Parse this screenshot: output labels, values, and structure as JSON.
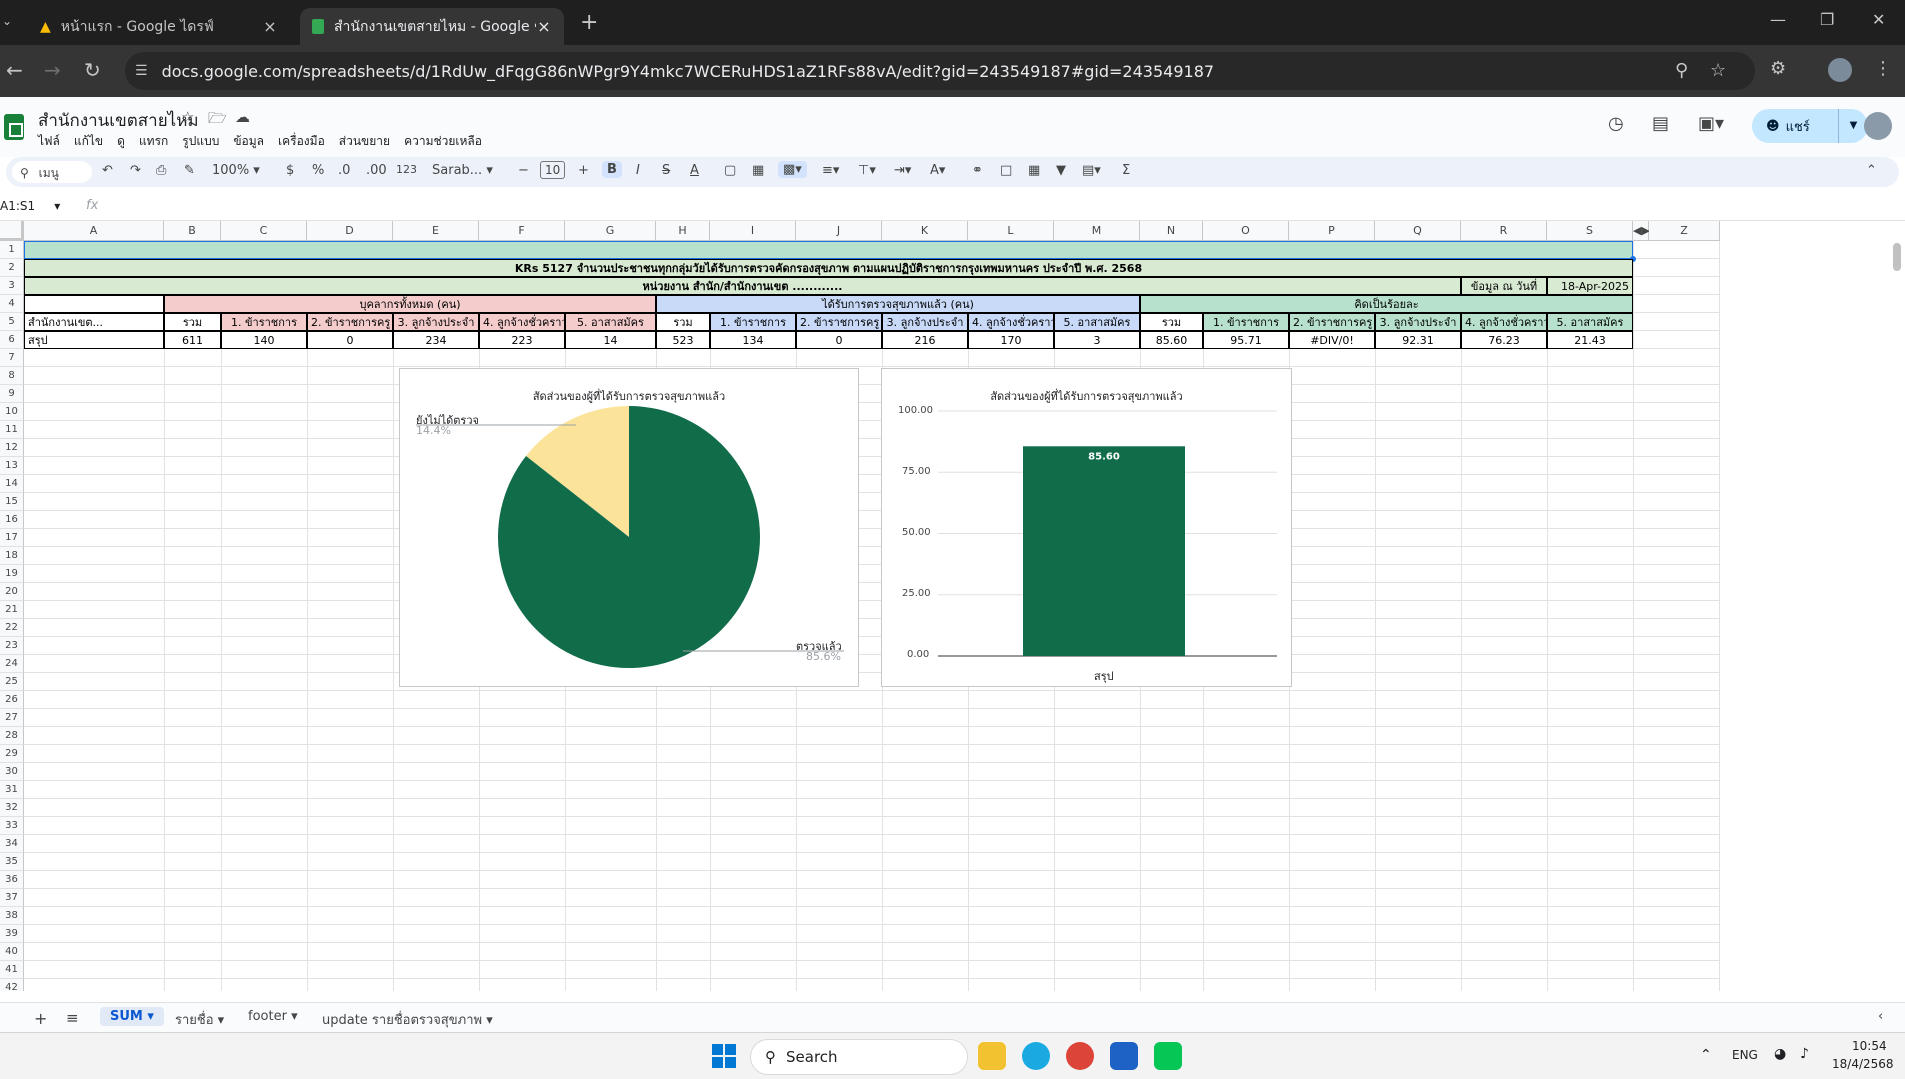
{
  "browser": {
    "tabs": [
      {
        "title": "หน้าแรก - Google ไดรฟ์"
      },
      {
        "title": "สำนักงานเขตสายไหม - Google ชีต"
      }
    ],
    "url": "docs.google.com/spreadsheets/d/1RdUw_dFqgG86nWPgr9Y4mkc7WCERuHDS1aZ1RFs88vA/edit?gid=243549187#gid=243549187"
  },
  "sheets": {
    "doc_title": "สำนักงานเขตสายไหม",
    "menu": [
      "ไฟล์",
      "แก้ไข",
      "ดู",
      "แทรก",
      "รูปแบบ",
      "ข้อมูล",
      "เครื่องมือ",
      "ส่วนขยาย",
      "ความช่วยเหลือ"
    ],
    "share_label": "แชร์",
    "toolbar": {
      "search": "เมนู",
      "zoom": "100%",
      "currency": "$",
      "percent": "%",
      "dec_less": ".0",
      "dec_more": ".00",
      "num_format": "123",
      "font": "Sarab...",
      "font_size": "10"
    },
    "name_box": "A1:S1",
    "fx": "fx"
  },
  "columns": [
    "A",
    "B",
    "C",
    "D",
    "E",
    "F",
    "G",
    "H",
    "I",
    "J",
    "K",
    "L",
    "M",
    "N",
    "O",
    "P",
    "Q",
    "R",
    "S",
    "Z"
  ],
  "rows": [
    "1",
    "2",
    "3",
    "4",
    "5",
    "6",
    "7",
    "8",
    "9",
    "10",
    "11",
    "12",
    "13",
    "14",
    "15",
    "16",
    "17",
    "18",
    "19",
    "20",
    "21",
    "22",
    "23",
    "24",
    "25",
    "26",
    "27",
    "28",
    "29",
    "30",
    "31",
    "32",
    "33",
    "34",
    "35",
    "36",
    "37",
    "38",
    "39",
    "40",
    "41",
    "42"
  ],
  "table": {
    "title": "KRs 5127 จำนวนประชาชนทุกกลุ่มวัยได้รับการตรวจคัดกรองสุขภาพ ตามแผนปฏิบัติราชการกรุงเทพมหานคร ประจำปี พ.ศ. 2568",
    "unit_line": "หน่วยงาน สำนัก/สำนักงานเขต ............",
    "date_label": "ข้อมูล ณ วันที่",
    "date_value": "18-Apr-2025",
    "group_all": "บุคลากรทั้งหมด (คน)",
    "group_checked": "ได้รับการตรวจสุขภาพแล้ว (คน)",
    "group_percent": "คิดเป็นร้อยละ",
    "col_a_header": "สำนักงานเขต...",
    "sub_headers": [
      "รวม",
      "1. ข้าราชการ",
      "2. ข้าราชการครู",
      "3. ลูกจ้างประจำ",
      "4. ลูกจ้างชั่วคราว",
      "5. อาสาสมัคร"
    ],
    "summary_label": "สรุป",
    "summary_values": [
      "611",
      "140",
      "0",
      "234",
      "223",
      "14",
      "523",
      "134",
      "0",
      "216",
      "170",
      "3",
      "85.60",
      "95.71",
      "#DIV/0!",
      "92.31",
      "76.23",
      "21.43"
    ]
  },
  "charts": {
    "pie": {
      "title": "สัดส่วนของผู้ที่ได้รับการตรวจสุขภาพแล้ว",
      "slices": [
        {
          "label": "ตรวจแล้ว",
          "percent": "85.6%",
          "value": 85.6,
          "color": "#116c4a"
        },
        {
          "label": "ยังไม่ได้ตรวจ",
          "percent": "14.4%",
          "value": 14.4,
          "color": "#fce39a"
        }
      ]
    },
    "bar": {
      "title": "สัดส่วนของผู้ที่ได้รับการตรวจสุขภาพแล้ว",
      "ticks": [
        "100.00",
        "75.00",
        "50.00",
        "25.00",
        "0.00"
      ],
      "category": "สรุป",
      "value": 85.6,
      "value_label": "85.60",
      "ylim": [
        0,
        100
      ],
      "color": "#116c4a"
    }
  },
  "sheet_tabs": [
    "SUM",
    "รายชื่อ",
    "footer",
    "update รายชื่อตรวจสุขภาพ"
  ],
  "taskbar": {
    "search": "Search",
    "lang": "ENG",
    "time": "10:54",
    "date": "18/4/2568"
  },
  "colors": {
    "header_green": "#b7e1cd",
    "header_red": "#f4cccc",
    "header_blue": "#c9daf8",
    "light_green": "#d9ead3",
    "chart_dark_green": "#116c4a"
  }
}
